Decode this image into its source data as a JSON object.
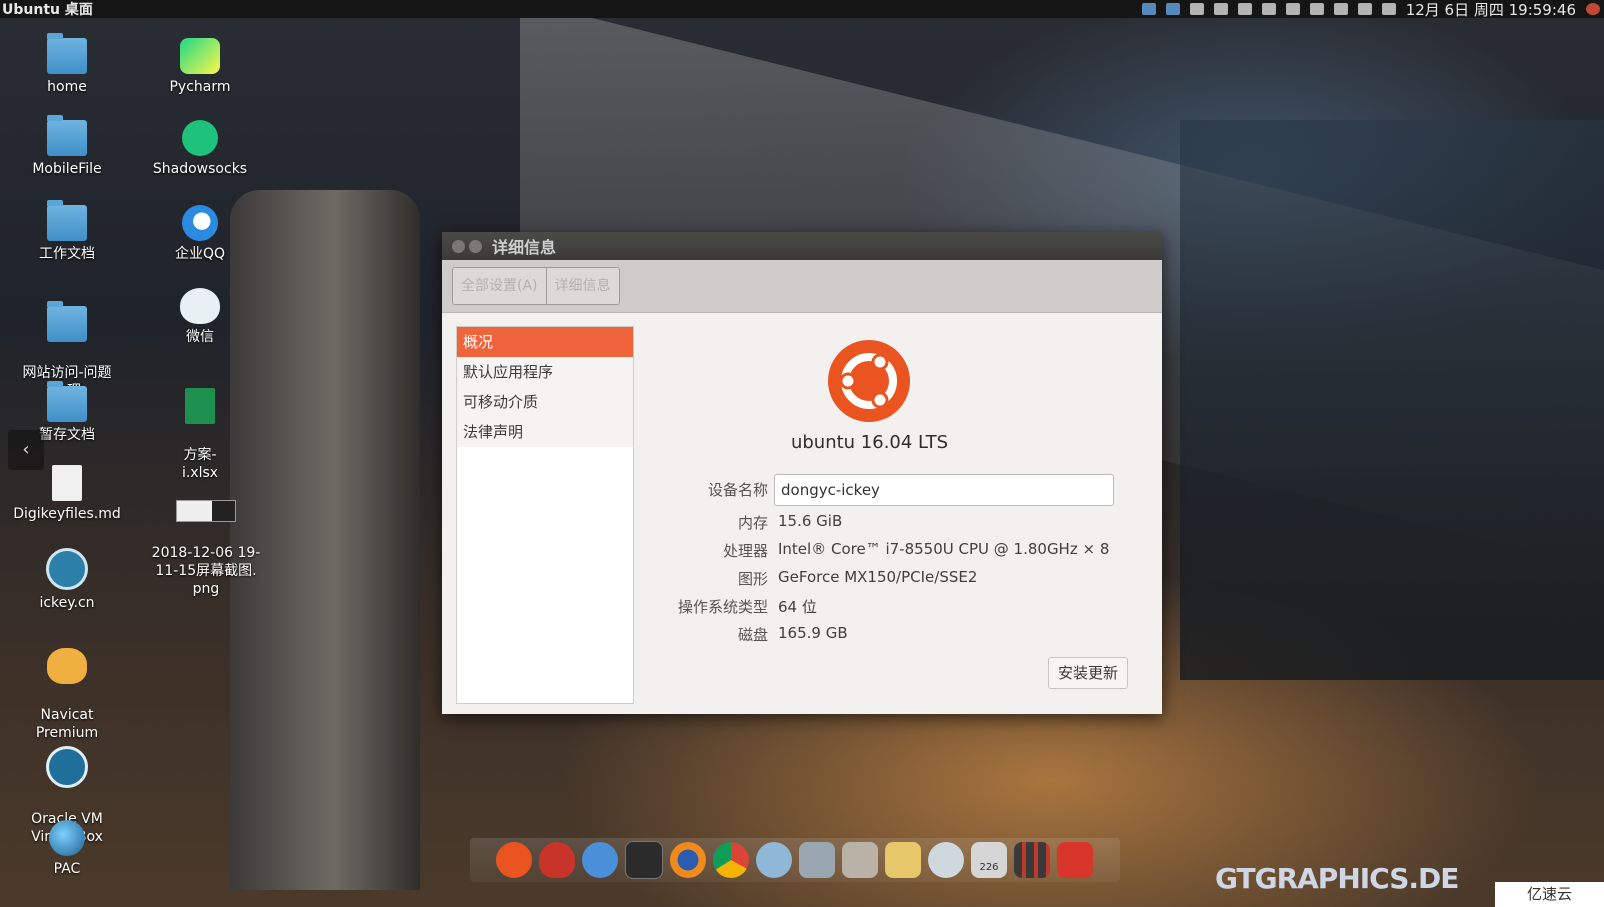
{
  "panel": {
    "title": "Ubuntu 桌面",
    "clock": "12月 6日 周四 19:59:46"
  },
  "desktop_icons": [
    {
      "label": "home",
      "icon": "home-folder-icon"
    },
    {
      "label": "MobileFile",
      "icon": "folder-icon"
    },
    {
      "label": "工作文档",
      "icon": "folder-icon"
    },
    {
      "label": "网站访问-问题\n处理",
      "icon": "folder-icon"
    },
    {
      "label": "暂存文档",
      "icon": "folder-icon"
    },
    {
      "label": "Digikeyfiles.md",
      "icon": "document-icon"
    },
    {
      "label": "ickey.cn",
      "icon": "ickey-app-icon"
    },
    {
      "label": "Navicat\nPremium",
      "icon": "navicat-icon"
    },
    {
      "label": "Oracle VM\nVirtualBox",
      "icon": "virtualbox-icon"
    },
    {
      "label": "PAC",
      "icon": "pac-globe-icon"
    },
    {
      "label": "Pycharm",
      "icon": "pycharm-icon"
    },
    {
      "label": "Shadowsocks",
      "icon": "shadowsocks-icon"
    },
    {
      "label": "企业QQ",
      "icon": "qq-enterprise-icon"
    },
    {
      "label": "微信",
      "icon": "wechat-icon"
    },
    {
      "label": "方案-\ni.xlsx",
      "icon": "xlsx-icon"
    },
    {
      "label": "2018-12-06 19-\n11-15屏幕截图.\npng",
      "icon": "image-thumbnail-icon"
    }
  ],
  "window": {
    "title": "详细信息",
    "toolbar": {
      "all_settings": "全部设置(A)",
      "details": "详细信息"
    },
    "sidebar": [
      {
        "label": "概况",
        "active": true
      },
      {
        "label": "默认应用程序",
        "active": false
      },
      {
        "label": "可移动介质",
        "active": false
      },
      {
        "label": "法律声明",
        "active": false
      }
    ],
    "os_name": "ubuntu 16.04 LTS",
    "device_name_label": "设备名称",
    "device_name_value": "dongyc-ickey",
    "memory_label": "内存",
    "memory_value": "15.6 GiB",
    "processor_label": "处理器",
    "processor_value": "Intel® Core™ i7-8550U CPU @ 1.80GHz × 8",
    "graphics_label": "图形",
    "graphics_value": "GeForce MX150/PCIe/SSE2",
    "os_type_label": "操作系统类型",
    "os_type_value": "64 位",
    "disk_label": "磁盘",
    "disk_value": "165.9 GB",
    "install_updates": "安装更新"
  },
  "dock": {
    "items": [
      "ubuntu-icon",
      "flame-icon",
      "finder-icon",
      "terminal-icon",
      "firefox-icon",
      "chrome-icon",
      "mail-icon",
      "network-icon",
      "files-icon",
      "text-editor-icon",
      "wechat-icon",
      "trash-icon",
      "app-grid-icon",
      "power-icon"
    ],
    "trash_count": "226"
  },
  "watermark": "GTGRAPHICS.DE",
  "corner_logo": "亿速云",
  "colors": {
    "accent": "#f0643c",
    "ubuntu_orange": "#e95420"
  }
}
